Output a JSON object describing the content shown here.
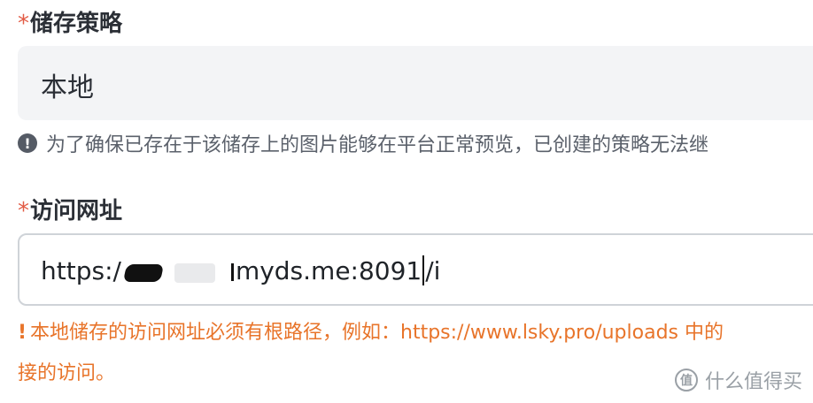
{
  "storage_strategy": {
    "required_mark": "*",
    "label": "储存策略",
    "value": "本地",
    "hint": "为了确保已存在于该储存上的图片能够在平台正常预览，已创建的策略无法继"
  },
  "access_url": {
    "required_mark": "*",
    "label": "访问网址",
    "value_prefix": "https:/",
    "value_mid": "myds.me:8091",
    "value_suffix": "/i",
    "warning_line1": "本地储存的访问网址必须有根路径，例如：https://www.lsky.pro/uploads 中的",
    "warning_line2": "接的访问。"
  },
  "watermark": {
    "text": "什么值得买",
    "logo_glyph": "值"
  },
  "colors": {
    "required": "#e25b45",
    "warning": "#e8742a",
    "hint": "#5b616b",
    "select_bg": "#f3f4f6"
  },
  "icons": {
    "hint_icon": "info-circle-icon",
    "warning_icon": "exclamation-icon"
  }
}
